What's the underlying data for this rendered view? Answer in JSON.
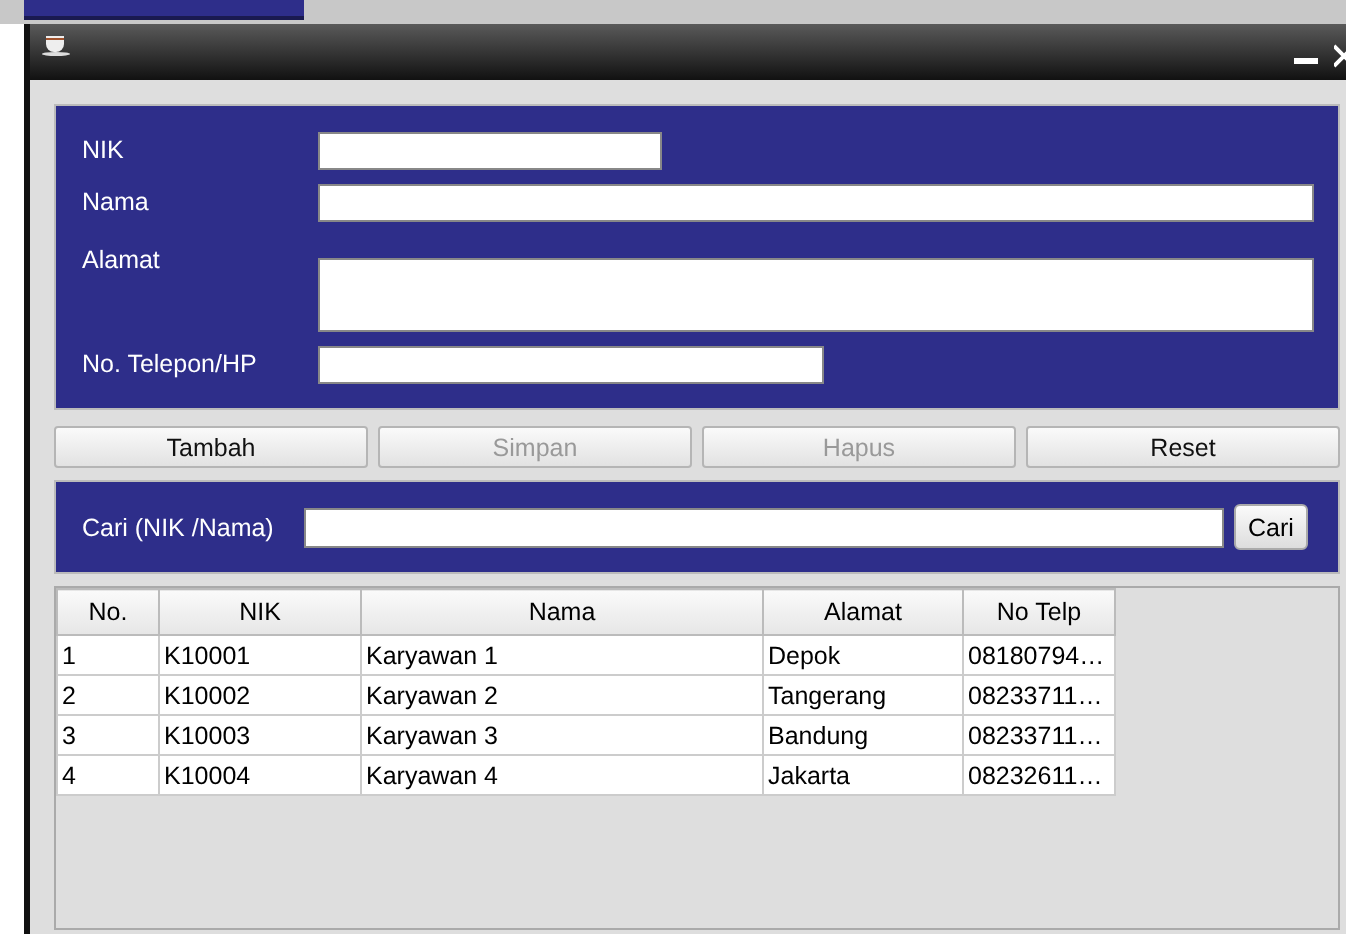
{
  "form": {
    "fields": [
      {
        "label": "NIK",
        "kind": "short"
      },
      {
        "label": "Nama",
        "kind": "wide"
      },
      {
        "label": "Alamat",
        "kind": "area"
      },
      {
        "label": "No. Telepon/HP",
        "kind": "medium"
      }
    ]
  },
  "actions": [
    {
      "label": "Tambah",
      "disabled": false
    },
    {
      "label": "Simpan",
      "disabled": true
    },
    {
      "label": "Hapus",
      "disabled": true
    },
    {
      "label": "Reset",
      "disabled": false
    }
  ],
  "search": {
    "label": "Cari (NIK /Nama)",
    "button": "Cari"
  },
  "table": {
    "columns": [
      "No.",
      "NIK",
      "Nama",
      "Alamat",
      "No Telp"
    ],
    "rows": [
      [
        "1",
        "K10001",
        "Karyawan 1",
        "Depok",
        "08180794…"
      ],
      [
        "2",
        "K10002",
        "Karyawan 2",
        "Tangerang",
        "08233711…"
      ],
      [
        "3",
        "K10003",
        "Karyawan 3",
        "Bandung",
        "08233711…"
      ],
      [
        "4",
        "K10004",
        "Karyawan 4",
        "Jakarta",
        "08232611…"
      ]
    ]
  }
}
